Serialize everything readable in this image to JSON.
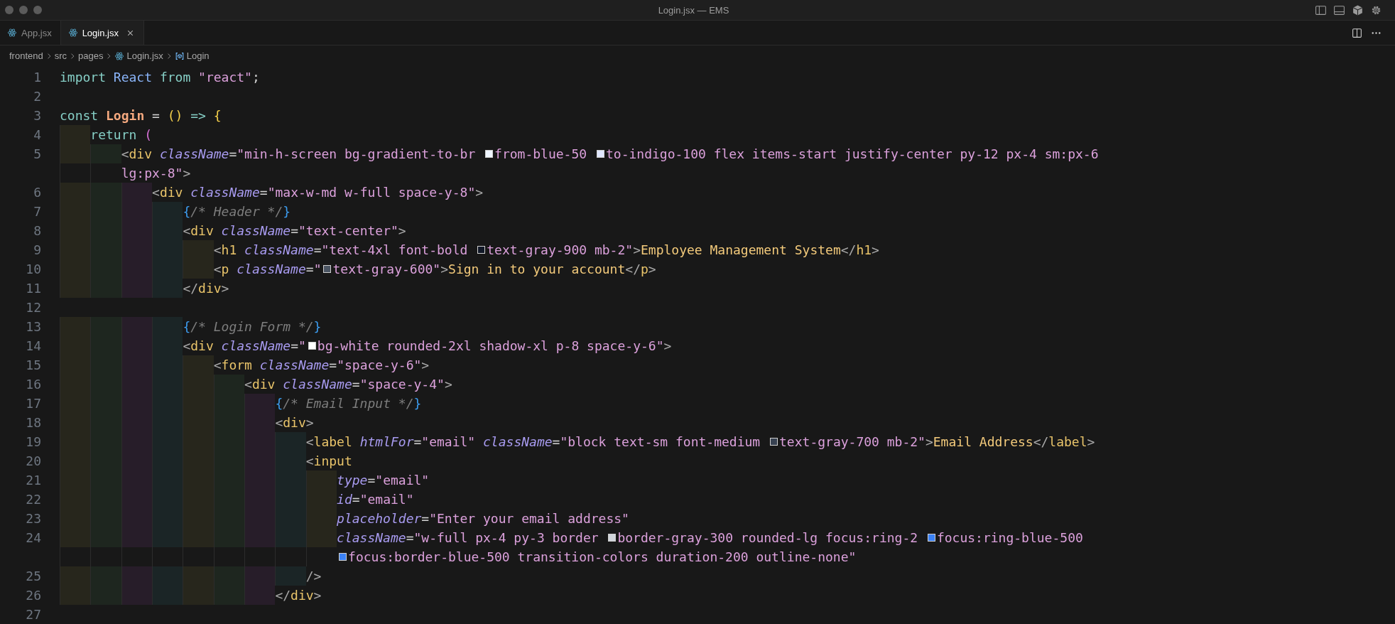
{
  "window": {
    "title": "Login.jsx — EMS"
  },
  "tabs": [
    {
      "label": "App.jsx",
      "selected": false
    },
    {
      "label": "Login.jsx",
      "selected": true
    }
  ],
  "breadcrumbs": [
    {
      "label": "frontend",
      "kind": "folder"
    },
    {
      "label": "src",
      "kind": "folder"
    },
    {
      "label": "pages",
      "kind": "folder"
    },
    {
      "label": "Login.jsx",
      "kind": "file"
    },
    {
      "label": "Login",
      "kind": "symbol"
    }
  ],
  "lines": [
    {
      "number": "1",
      "tokens": [
        {
          "kind": "keyword",
          "text": "import "
        },
        {
          "kind": "ident",
          "text": "React "
        },
        {
          "kind": "keyword",
          "text": "from "
        },
        {
          "kind": "string",
          "text": "\"react\""
        },
        {
          "kind": "op",
          "text": ";"
        }
      ]
    },
    {
      "number": "2"
    },
    {
      "number": "3",
      "tokens": [
        {
          "kind": "keyword",
          "text": "const "
        },
        {
          "kind": "func",
          "text": "Login"
        },
        {
          "kind": "op",
          "text": " = "
        },
        {
          "kind": "bracket",
          "text": "() "
        },
        {
          "kind": "keyword",
          "text": "=> "
        },
        {
          "kind": "bracket",
          "text": "{"
        }
      ]
    },
    {
      "number": "4",
      "guides": [
        {
          "color": "#27261c"
        }
      ],
      "tokens": [
        {
          "kind": "keyword",
          "text": "return "
        },
        {
          "kind": "paren",
          "text": "("
        }
      ]
    },
    {
      "number": "5",
      "guides": [
        {
          "color": "#27261c"
        },
        {
          "color": "#1e261f"
        }
      ],
      "tokens": [
        {
          "kind": "punct",
          "text": "<"
        },
        {
          "kind": "tag",
          "text": "div "
        },
        {
          "kind": "attr",
          "text": "className"
        },
        {
          "kind": "op",
          "text": "="
        },
        {
          "kind": "string",
          "text": "\"min-h-screen bg-gradient-to-br "
        },
        {
          "kind": "swatch",
          "color": "#eff6ff"
        },
        {
          "kind": "string",
          "text": "from-blue-50 "
        },
        {
          "kind": "swatch",
          "color": "#e0e7ff"
        },
        {
          "kind": "string",
          "text": "to-indigo-100 flex items-start justify-center py-12 px-4 sm:px-6"
        }
      ],
      "wrap": [
        {
          "kind": "string",
          "text": "lg:px-8\""
        },
        {
          "kind": "punct",
          "text": ">"
        }
      ]
    },
    {
      "number": "6",
      "guides": [
        {
          "color": "#27261c"
        },
        {
          "color": "#1e261f"
        },
        {
          "color": "#271d29"
        }
      ],
      "tokens": [
        {
          "kind": "punct",
          "text": "<"
        },
        {
          "kind": "tag",
          "text": "div "
        },
        {
          "kind": "attr",
          "text": "className"
        },
        {
          "kind": "op",
          "text": "="
        },
        {
          "kind": "string",
          "text": "\"max-w-md w-full space-y-8\""
        },
        {
          "kind": "punct",
          "text": ">"
        }
      ]
    },
    {
      "number": "7",
      "guides": [
        {
          "color": "#27261c"
        },
        {
          "color": "#1e261f"
        },
        {
          "color": "#271d29"
        },
        {
          "color": "#1b2526"
        }
      ],
      "tokens": [
        {
          "kind": "jsxbrace",
          "text": "{"
        },
        {
          "kind": "comment",
          "text": "/* Header */"
        },
        {
          "kind": "jsxbrace",
          "text": "}"
        }
      ]
    },
    {
      "number": "8",
      "guides": [
        {
          "color": "#27261c"
        },
        {
          "color": "#1e261f"
        },
        {
          "color": "#271d29"
        },
        {
          "color": "#1b2526"
        }
      ],
      "tokens": [
        {
          "kind": "punct",
          "text": "<"
        },
        {
          "kind": "tag",
          "text": "div "
        },
        {
          "kind": "attr",
          "text": "className"
        },
        {
          "kind": "op",
          "text": "="
        },
        {
          "kind": "string",
          "text": "\"text-center\""
        },
        {
          "kind": "punct",
          "text": ">"
        }
      ]
    },
    {
      "number": "9",
      "guides": [
        {
          "color": "#27261c"
        },
        {
          "color": "#1e261f"
        },
        {
          "color": "#271d29"
        },
        {
          "color": "#1b2526"
        },
        {
          "color": "#27261c"
        }
      ],
      "tokens": [
        {
          "kind": "punct",
          "text": "<"
        },
        {
          "kind": "tag",
          "text": "h1 "
        },
        {
          "kind": "attr",
          "text": "className"
        },
        {
          "kind": "op",
          "text": "="
        },
        {
          "kind": "string",
          "text": "\"text-4xl font-bold "
        },
        {
          "kind": "swatch",
          "color": "#111827"
        },
        {
          "kind": "string",
          "text": "text-gray-900 mb-2\""
        },
        {
          "kind": "punct",
          "text": ">"
        },
        {
          "kind": "text",
          "text": "Employee Management System"
        },
        {
          "kind": "punct",
          "text": "</"
        },
        {
          "kind": "tag",
          "text": "h1"
        },
        {
          "kind": "punct",
          "text": ">"
        }
      ]
    },
    {
      "number": "10",
      "guides": [
        {
          "color": "#27261c"
        },
        {
          "color": "#1e261f"
        },
        {
          "color": "#271d29"
        },
        {
          "color": "#1b2526"
        },
        {
          "color": "#27261c"
        }
      ],
      "tokens": [
        {
          "kind": "punct",
          "text": "<"
        },
        {
          "kind": "tag",
          "text": "p "
        },
        {
          "kind": "attr",
          "text": "className"
        },
        {
          "kind": "op",
          "text": "="
        },
        {
          "kind": "string",
          "text": "\""
        },
        {
          "kind": "swatch",
          "color": "#4b5563"
        },
        {
          "kind": "string",
          "text": "text-gray-600\""
        },
        {
          "kind": "punct",
          "text": ">"
        },
        {
          "kind": "text",
          "text": "Sign in to your account"
        },
        {
          "kind": "punct",
          "text": "</"
        },
        {
          "kind": "tag",
          "text": "p"
        },
        {
          "kind": "punct",
          "text": ">"
        }
      ]
    },
    {
      "number": "11",
      "guides": [
        {
          "color": "#27261c"
        },
        {
          "color": "#1e261f"
        },
        {
          "color": "#271d29"
        },
        {
          "color": "#1b2526"
        }
      ],
      "tokens": [
        {
          "kind": "punct",
          "text": "</"
        },
        {
          "kind": "tag",
          "text": "div"
        },
        {
          "kind": "punct",
          "text": ">"
        }
      ]
    },
    {
      "number": "12"
    },
    {
      "number": "13",
      "guides": [
        {
          "color": "#27261c"
        },
        {
          "color": "#1e261f"
        },
        {
          "color": "#271d29"
        },
        {
          "color": "#1b2526"
        }
      ],
      "tokens": [
        {
          "kind": "jsxbrace",
          "text": "{"
        },
        {
          "kind": "comment",
          "text": "/* Login Form */"
        },
        {
          "kind": "jsxbrace",
          "text": "}"
        }
      ]
    },
    {
      "number": "14",
      "guides": [
        {
          "color": "#27261c"
        },
        {
          "color": "#1e261f"
        },
        {
          "color": "#271d29"
        },
        {
          "color": "#1b2526"
        }
      ],
      "tokens": [
        {
          "kind": "punct",
          "text": "<"
        },
        {
          "kind": "tag",
          "text": "div "
        },
        {
          "kind": "attr",
          "text": "className"
        },
        {
          "kind": "op",
          "text": "="
        },
        {
          "kind": "string",
          "text": "\""
        },
        {
          "kind": "swatch",
          "color": "#ffffff"
        },
        {
          "kind": "string",
          "text": "bg-white rounded-2xl shadow-xl p-8 space-y-6\""
        },
        {
          "kind": "punct",
          "text": ">"
        }
      ]
    },
    {
      "number": "15",
      "guides": [
        {
          "color": "#27261c"
        },
        {
          "color": "#1e261f"
        },
        {
          "color": "#271d29"
        },
        {
          "color": "#1b2526"
        },
        {
          "color": "#27261c"
        }
      ],
      "tokens": [
        {
          "kind": "punct",
          "text": "<"
        },
        {
          "kind": "tag",
          "text": "form "
        },
        {
          "kind": "attr",
          "text": "className"
        },
        {
          "kind": "op",
          "text": "="
        },
        {
          "kind": "string",
          "text": "\"space-y-6\""
        },
        {
          "kind": "punct",
          "text": ">"
        }
      ]
    },
    {
      "number": "16",
      "guides": [
        {
          "color": "#27261c"
        },
        {
          "color": "#1e261f"
        },
        {
          "color": "#271d29"
        },
        {
          "color": "#1b2526"
        },
        {
          "color": "#27261c"
        },
        {
          "color": "#1e261f"
        }
      ],
      "tokens": [
        {
          "kind": "punct",
          "text": "<"
        },
        {
          "kind": "tag",
          "text": "div "
        },
        {
          "kind": "attr",
          "text": "className"
        },
        {
          "kind": "op",
          "text": "="
        },
        {
          "kind": "string",
          "text": "\"space-y-4\""
        },
        {
          "kind": "punct",
          "text": ">"
        }
      ]
    },
    {
      "number": "17",
      "guides": [
        {
          "color": "#27261c"
        },
        {
          "color": "#1e261f"
        },
        {
          "color": "#271d29"
        },
        {
          "color": "#1b2526"
        },
        {
          "color": "#27261c"
        },
        {
          "color": "#1e261f"
        },
        {
          "color": "#271d29"
        }
      ],
      "tokens": [
        {
          "kind": "jsxbrace",
          "text": "{"
        },
        {
          "kind": "comment",
          "text": "/* Email Input */"
        },
        {
          "kind": "jsxbrace",
          "text": "}"
        }
      ]
    },
    {
      "number": "18",
      "guides": [
        {
          "color": "#27261c"
        },
        {
          "color": "#1e261f"
        },
        {
          "color": "#271d29"
        },
        {
          "color": "#1b2526"
        },
        {
          "color": "#27261c"
        },
        {
          "color": "#1e261f"
        },
        {
          "color": "#271d29"
        }
      ],
      "tokens": [
        {
          "kind": "punct",
          "text": "<"
        },
        {
          "kind": "tag",
          "text": "div"
        },
        {
          "kind": "punct",
          "text": ">"
        }
      ]
    },
    {
      "number": "19",
      "guides": [
        {
          "color": "#27261c"
        },
        {
          "color": "#1e261f"
        },
        {
          "color": "#271d29"
        },
        {
          "color": "#1b2526"
        },
        {
          "color": "#27261c"
        },
        {
          "color": "#1e261f"
        },
        {
          "color": "#271d29"
        },
        {
          "color": "#1b2526"
        }
      ],
      "tokens": [
        {
          "kind": "punct",
          "text": "<"
        },
        {
          "kind": "tag",
          "text": "label "
        },
        {
          "kind": "attr",
          "text": "htmlFor"
        },
        {
          "kind": "op",
          "text": "="
        },
        {
          "kind": "string",
          "text": "\"email\" "
        },
        {
          "kind": "attr",
          "text": "className"
        },
        {
          "kind": "op",
          "text": "="
        },
        {
          "kind": "string",
          "text": "\"block text-sm font-medium "
        },
        {
          "kind": "swatch",
          "color": "#374151"
        },
        {
          "kind": "string",
          "text": "text-gray-700 mb-2\""
        },
        {
          "kind": "punct",
          "text": ">"
        },
        {
          "kind": "text",
          "text": "Email Address"
        },
        {
          "kind": "punct",
          "text": "</"
        },
        {
          "kind": "tag",
          "text": "label"
        },
        {
          "kind": "punct",
          "text": ">"
        }
      ]
    },
    {
      "number": "20",
      "guides": [
        {
          "color": "#27261c"
        },
        {
          "color": "#1e261f"
        },
        {
          "color": "#271d29"
        },
        {
          "color": "#1b2526"
        },
        {
          "color": "#27261c"
        },
        {
          "color": "#1e261f"
        },
        {
          "color": "#271d29"
        },
        {
          "color": "#1b2526"
        }
      ],
      "tokens": [
        {
          "kind": "punct",
          "text": "<"
        },
        {
          "kind": "tag",
          "text": "input"
        }
      ]
    },
    {
      "number": "21",
      "guides": [
        {
          "color": "#27261c"
        },
        {
          "color": "#1e261f"
        },
        {
          "color": "#271d29"
        },
        {
          "color": "#1b2526"
        },
        {
          "color": "#27261c"
        },
        {
          "color": "#1e261f"
        },
        {
          "color": "#271d29"
        },
        {
          "color": "#1b2526"
        },
        {
          "color": "#27261c"
        }
      ],
      "tokens": [
        {
          "kind": "attr",
          "text": "type"
        },
        {
          "kind": "op",
          "text": "="
        },
        {
          "kind": "string",
          "text": "\"email\""
        }
      ]
    },
    {
      "number": "22",
      "guides": [
        {
          "color": "#27261c"
        },
        {
          "color": "#1e261f"
        },
        {
          "color": "#271d29"
        },
        {
          "color": "#1b2526"
        },
        {
          "color": "#27261c"
        },
        {
          "color": "#1e261f"
        },
        {
          "color": "#271d29"
        },
        {
          "color": "#1b2526"
        },
        {
          "color": "#27261c"
        }
      ],
      "tokens": [
        {
          "kind": "attr",
          "text": "id"
        },
        {
          "kind": "op",
          "text": "="
        },
        {
          "kind": "string",
          "text": "\"email\""
        }
      ]
    },
    {
      "number": "23",
      "guides": [
        {
          "color": "#27261c"
        },
        {
          "color": "#1e261f"
        },
        {
          "color": "#271d29"
        },
        {
          "color": "#1b2526"
        },
        {
          "color": "#27261c"
        },
        {
          "color": "#1e261f"
        },
        {
          "color": "#271d29"
        },
        {
          "color": "#1b2526"
        },
        {
          "color": "#27261c"
        }
      ],
      "tokens": [
        {
          "kind": "attr",
          "text": "placeholder"
        },
        {
          "kind": "op",
          "text": "="
        },
        {
          "kind": "string",
          "text": "\"Enter your email address\""
        }
      ]
    },
    {
      "number": "24",
      "guides": [
        {
          "color": "#27261c"
        },
        {
          "color": "#1e261f"
        },
        {
          "color": "#271d29"
        },
        {
          "color": "#1b2526"
        },
        {
          "color": "#27261c"
        },
        {
          "color": "#1e261f"
        },
        {
          "color": "#271d29"
        },
        {
          "color": "#1b2526"
        },
        {
          "color": "#27261c"
        }
      ],
      "tokens": [
        {
          "kind": "attr",
          "text": "className"
        },
        {
          "kind": "op",
          "text": "="
        },
        {
          "kind": "string",
          "text": "\"w-full px-4 py-3 border "
        },
        {
          "kind": "swatch",
          "color": "#d1d5db"
        },
        {
          "kind": "string",
          "text": "border-gray-300 rounded-lg focus:ring-2 "
        },
        {
          "kind": "swatch",
          "color": "#3b82f6"
        },
        {
          "kind": "string",
          "text": "focus:ring-blue-500"
        }
      ],
      "wrap": [
        {
          "kind": "swatch",
          "color": "#3b82f6"
        },
        {
          "kind": "string",
          "text": "focus:border-blue-500 transition-colors duration-200 outline-none\""
        }
      ]
    },
    {
      "number": "25",
      "guides": [
        {
          "color": "#27261c"
        },
        {
          "color": "#1e261f"
        },
        {
          "color": "#271d29"
        },
        {
          "color": "#1b2526"
        },
        {
          "color": "#27261c"
        },
        {
          "color": "#1e261f"
        },
        {
          "color": "#271d29"
        },
        {
          "color": "#1b2526"
        }
      ],
      "tokens": [
        {
          "kind": "punct",
          "text": "/>"
        }
      ]
    },
    {
      "number": "26",
      "guides": [
        {
          "color": "#27261c"
        },
        {
          "color": "#1e261f"
        },
        {
          "color": "#271d29"
        },
        {
          "color": "#1b2526"
        },
        {
          "color": "#27261c"
        },
        {
          "color": "#1e261f"
        },
        {
          "color": "#271d29"
        }
      ],
      "tokens": [
        {
          "kind": "punct",
          "text": "</"
        },
        {
          "kind": "tag",
          "text": "div"
        },
        {
          "kind": "punct",
          "text": ">"
        }
      ]
    },
    {
      "number": "27"
    }
  ]
}
